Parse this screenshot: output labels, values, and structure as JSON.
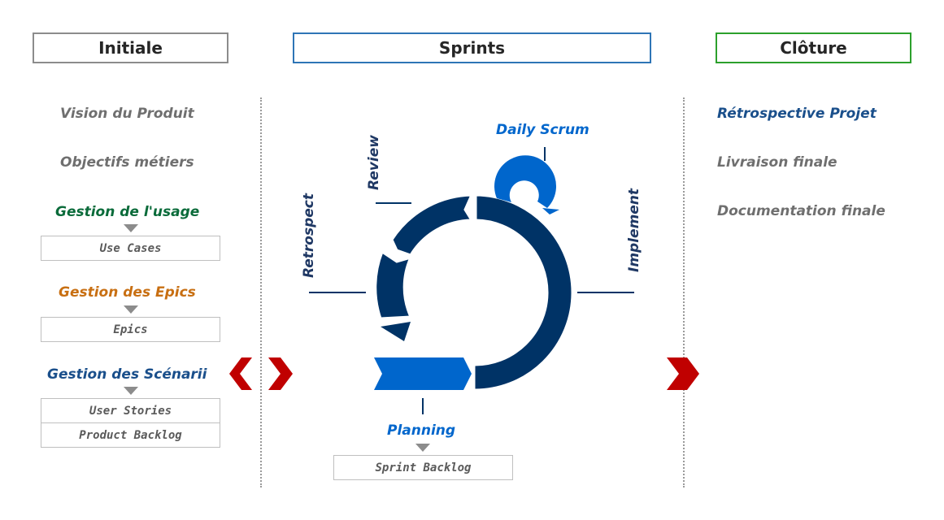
{
  "phases": {
    "initiale": "Initiale",
    "sprints": "Sprints",
    "cloture": "Clôture"
  },
  "initiale": {
    "vision": "Vision du Produit",
    "objectifs": "Objectifs métiers",
    "usage": "Gestion de l'usage",
    "usage_box": "Use Cases",
    "epics": "Gestion des Epics",
    "epics_box": "Epics",
    "scenarii": "Gestion des Scénarii",
    "user_stories": "User Stories",
    "product_backlog": "Product Backlog"
  },
  "sprints": {
    "daily_scrum": "Daily Scrum",
    "review": "Review",
    "retrospect": "Retrospect",
    "implement": "Implement",
    "planning": "Planning",
    "sprint_backlog": "Sprint Backlog"
  },
  "cloture": {
    "retro_projet": "Rétrospective Projet",
    "livraison": "Livraison finale",
    "documentation": "Documentation finale"
  },
  "colors": {
    "dark_blue": "#003366",
    "bright_blue": "#0066cc",
    "green": "#0a6b3a",
    "orange": "#c86f12",
    "red": "#c00000"
  }
}
